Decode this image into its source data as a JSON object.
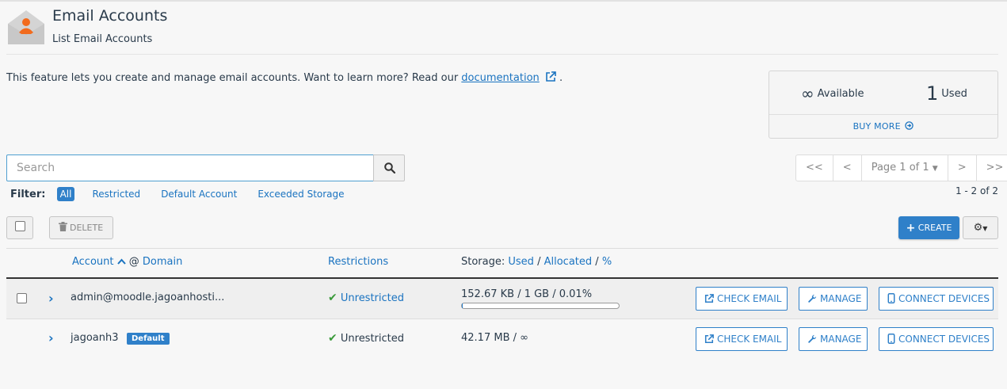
{
  "header": {
    "title": "Email Accounts",
    "subtitle": "List Email Accounts",
    "icon": "email-accounts-icon"
  },
  "description": {
    "text": "This feature lets you create and manage email accounts. Want to learn more? Read our ",
    "link_label": "documentation",
    "suffix": " ."
  },
  "stats": {
    "available_value": "∞",
    "available_label": "Available",
    "used_value": "1",
    "used_label": "Used",
    "buy_more": "BUY MORE"
  },
  "search": {
    "placeholder": "Search"
  },
  "filter": {
    "label": "Filter:",
    "options": [
      "All",
      "Restricted",
      "Default Account",
      "Exceeded Storage"
    ],
    "selected": "All"
  },
  "pagination": {
    "first": "<<",
    "prev": "<",
    "page_label": "Page 1 of 1",
    "next": ">",
    "last": ">>",
    "count": "1 - 2 of 2"
  },
  "toolbar": {
    "delete_label": "DELETE",
    "create_label": "CREATE"
  },
  "table": {
    "headers": {
      "account": "Account",
      "at": "@",
      "domain": "Domain",
      "restrictions": "Restrictions",
      "storage_prefix": "Storage:",
      "used": "Used",
      "sep": "/",
      "allocated": "Allocated",
      "percent": "%"
    },
    "rows": [
      {
        "account": "admin@moodle.jagoanhosti...",
        "badge": "",
        "restriction": "Unrestricted",
        "storage": "152.67 KB / 1 GB / 0.01%",
        "usage_fraction": 0.0001,
        "actions": [
          "CHECK EMAIL",
          "MANAGE",
          "CONNECT DEVICES"
        ]
      },
      {
        "account": "jagoanh3",
        "badge": "Default",
        "restriction": "Unrestricted",
        "storage": "42.17 MB / ∞",
        "actions": [
          "CHECK EMAIL",
          "MANAGE",
          "CONNECT DEVICES"
        ]
      }
    ]
  },
  "colors": {
    "accent": "#2f80c9",
    "link": "#1a73c0",
    "success": "#3a9a3a",
    "icon_orange": "#f26b1d"
  }
}
